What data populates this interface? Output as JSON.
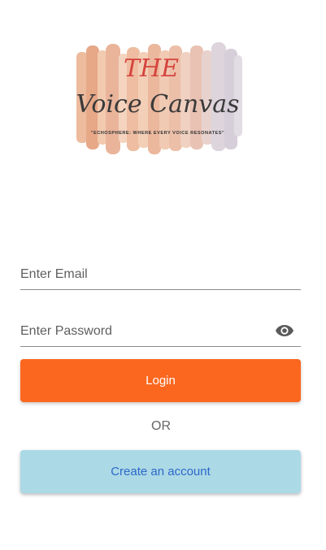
{
  "logo": {
    "title_line1": "THE",
    "title_line2": "Voice Canvas",
    "tagline": "\"ECHOSPHERE: WHERE EVERY VOICE RESONATES\"",
    "colors": {
      "peach": "#e9a27f",
      "lavender": "#cfc6d3",
      "red_script": "#d6443e",
      "dark_script": "#3a3a3a"
    }
  },
  "form": {
    "email_placeholder": "Enter Email",
    "password_placeholder": "Enter Password",
    "password_toggle_icon": "eye-icon",
    "login_label": "Login",
    "or_label": "OR",
    "create_account_label": "Create an account"
  },
  "colors": {
    "login_bg": "#fb671f",
    "login_text": "#ffffff",
    "create_bg": "#acd9e6",
    "create_text": "#2b69c8",
    "underline": "#8a8a8a"
  }
}
